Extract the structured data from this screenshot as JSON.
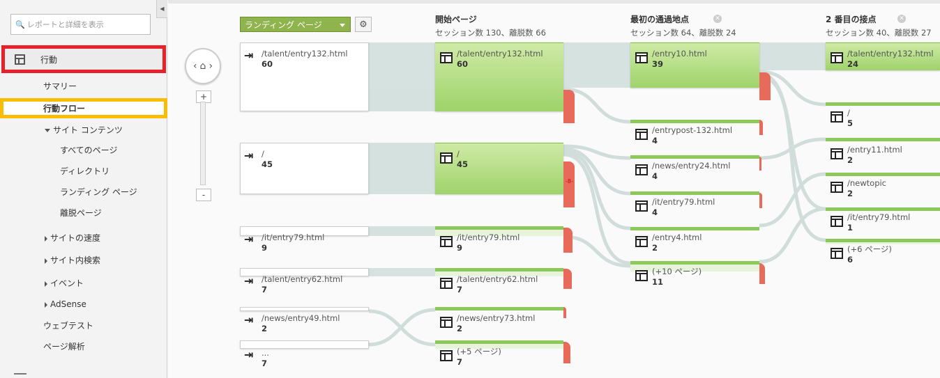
{
  "sidebar": {
    "search_placeholder": "レポートと詳細を表示",
    "section_title": "行動",
    "items": [
      "サマリー",
      "行動フロー",
      "サイト コンテンツ",
      "すべてのページ",
      "ディレクトリ",
      "ランディング ページ",
      "離脱ページ",
      "サイトの速度",
      "サイト内検索",
      "イベント",
      "AdSense",
      "ウェブテスト",
      "ページ解析"
    ]
  },
  "toolbar": {
    "dimension": "ランディング ページ"
  },
  "columns": [
    {
      "title": "開始ページ",
      "stats": "セッション数 130、離脱数 66"
    },
    {
      "title": "最初の通過地点",
      "stats": "セッション数 64、離脱数 24"
    },
    {
      "title": "2 番目の接点",
      "stats": "セッション数 40、離脱数 27"
    }
  ],
  "landing": [
    {
      "label": "/talent/entry132.html",
      "value": "60"
    },
    {
      "label": "/",
      "value": "45"
    },
    {
      "label": "/it/entry79.html",
      "value": "9"
    },
    {
      "label": "/talent/entry62.html",
      "value": "7"
    },
    {
      "label": "/news/entry49.html",
      "value": "2"
    },
    {
      "label": "...",
      "value": "7"
    }
  ],
  "start": [
    {
      "label": "/talent/entry132.html",
      "value": "60"
    },
    {
      "label": "/",
      "value": "45"
    },
    {
      "label": "/it/entry79.html",
      "value": "9"
    },
    {
      "label": "/talent/entry62.html",
      "value": "7"
    },
    {
      "label": "/news/entry73.html",
      "value": "2"
    },
    {
      "label": "(+5 ページ)",
      "value": "7"
    }
  ],
  "first": [
    {
      "label": "/entry10.html",
      "value": "39"
    },
    {
      "label": "/entrypost-132.html",
      "value": "4"
    },
    {
      "label": "/news/entry24.html",
      "value": "4"
    },
    {
      "label": "/it/entry79.html",
      "value": "4"
    },
    {
      "label": "/entry4.html",
      "value": "2"
    },
    {
      "label": "(+10 ページ)",
      "value": "11"
    }
  ],
  "second": [
    {
      "label": "/talent/entry132.html",
      "value": "24"
    },
    {
      "label": "/",
      "value": "5"
    },
    {
      "label": "/entry11.html",
      "value": "2"
    },
    {
      "label": "/newtopic",
      "value": "2"
    },
    {
      "label": "/it/entry79.html",
      "value": "1"
    },
    {
      "label": "(+6 ページ)",
      "value": "6"
    }
  ],
  "drop_marker": "-8-"
}
